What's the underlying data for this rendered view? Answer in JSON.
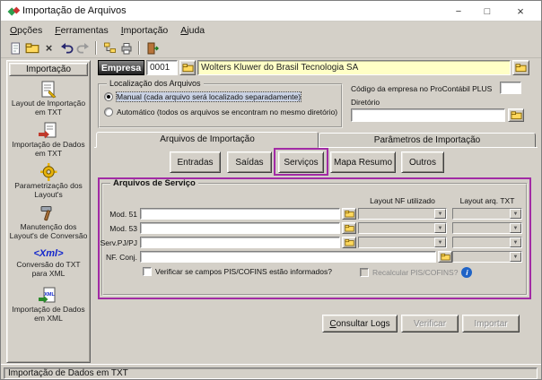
{
  "window": {
    "title": "Importação de Arquivos"
  },
  "icons": {
    "minimize": "−",
    "maximize": "□",
    "close": "×",
    "delete": "×",
    "dropdown": "▼",
    "info": "i"
  },
  "menubar": {
    "items": [
      {
        "label": "Opções"
      },
      {
        "label": "Ferramentas"
      },
      {
        "label": "Importação"
      },
      {
        "label": "Ajuda"
      }
    ]
  },
  "sidebar": {
    "header": "Importação",
    "items": [
      {
        "label": "Layout de Importação em TXT"
      },
      {
        "label": "Importação de Dados em TXT"
      },
      {
        "label": "Parametrização dos Layout's"
      },
      {
        "label": "Manutenção dos Layout's de Conversão"
      },
      {
        "label": "Conversão do TXT para XML",
        "icon_text": "<Xml>"
      },
      {
        "label": "Importação de Dados em XML"
      }
    ]
  },
  "empresa": {
    "label": "Empresa",
    "code": "0001",
    "name": "Wolters Kluwer do Brasil Tecnologia SA"
  },
  "localizacao": {
    "title": "Localização dos Arquivos",
    "manual": "Manual (cada arquivo será localizado separadamente)",
    "automatico": "Automático (todos os arquivos se encontram no mesmo diretório)"
  },
  "procontabil": {
    "codigo_label": "Código da empresa no ProContábil PLUS",
    "codigo_value": "",
    "diretorio_label": "Diretório",
    "diretorio_value": ""
  },
  "tabs": {
    "arquivos": "Arquivos de Importação",
    "parametros": "Parâmetros de Importação"
  },
  "subtabs": {
    "entradas": "Entradas",
    "saidas": "Saídas",
    "servicos": "Serviços",
    "mapa": "Mapa Resumo",
    "outros": "Outros"
  },
  "servico": {
    "title": "Arquivos de Serviço",
    "col_nf": "Layout NF utilizado",
    "col_txt": "Layout arq. TXT",
    "rows": [
      {
        "label": "Mod. 51",
        "file": ""
      },
      {
        "label": "Mod. 53",
        "file": ""
      },
      {
        "label": "Serv.PJ/PJ",
        "file": ""
      },
      {
        "label": "NF. Conj.",
        "file": ""
      }
    ],
    "check_pis": "Verificar se campos PIS/COFINS estão informados?",
    "check_recalc": "Recalcular PIS/COFINS?"
  },
  "actions": {
    "consultar": "Consultar Logs",
    "verificar": "Verificar",
    "importar": "Importar"
  },
  "statusbar": {
    "text": "Importação de Dados em TXT"
  },
  "colors": {
    "annotation": "#A22BA5",
    "field_yellow": "#FFFFC6",
    "face": "#D4D0C8"
  }
}
